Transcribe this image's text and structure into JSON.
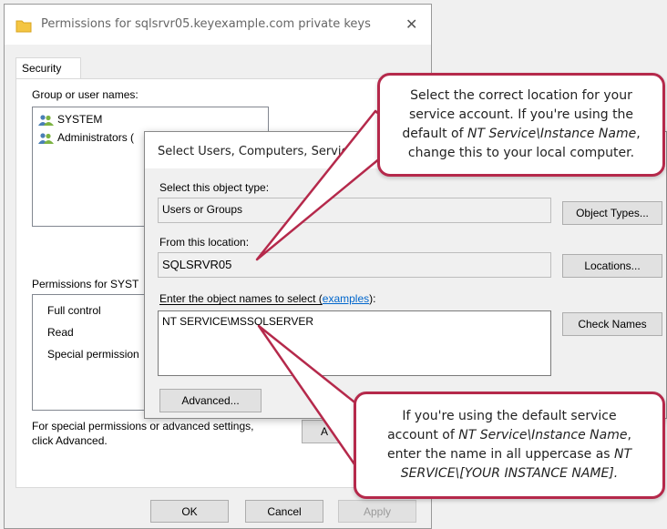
{
  "permissions_window": {
    "title": "Permissions for sqlsrvr05.keyexample.com private keys",
    "close_glyph": "✕",
    "tab_security": "Security",
    "group_label": "Group or user names:",
    "users": [
      "SYSTEM",
      "Administrators ("
    ],
    "perm_label": "Permissions for SYST",
    "perm_items": [
      "Full control",
      "Read",
      "Special permission"
    ],
    "special_text": "For special permissions or advanced settings,",
    "special_text2": "click Advanced.",
    "advanced_partial": "A",
    "ok": "OK",
    "cancel": "Cancel",
    "apply": "Apply"
  },
  "select_dialog": {
    "title": "Select Users, Computers, Servic  Ac",
    "object_type_label": "Select this object type:",
    "object_type_value": "Users or Groups",
    "object_types_button": "Object Types...",
    "location_label": "From this location:",
    "location_value": "SQLSRVR05",
    "locations_button": "Locations...",
    "names_label_prefix": "Enter the object names to select (",
    "names_label_link": "examples",
    "names_label_suffix": "):",
    "names_value": "NT SERVICE\\MSSQLSERVER",
    "check_names_button": "Check Names",
    "advanced_button": "Advanced..."
  },
  "callouts": {
    "top": {
      "line1": "Select the correct location for your",
      "line2": "service account. If you're using the",
      "line3_prefix": "default of ",
      "line3_italic": "NT Service\\Instance Name",
      "line3_suffix": ",",
      "line4": "change this to your local computer."
    },
    "bottom": {
      "line1": "If you're using the default service",
      "line2_prefix": "account of ",
      "line2_italic": "NT Service\\Instance Name",
      "line2_suffix": ",",
      "line3_prefix": "enter the name in all uppercase as ",
      "line3_italic": "NT",
      "line4_italic": "SERVICE\\[YOUR INSTANCE NAME].",
      "line4_suffix": ""
    }
  },
  "colors": {
    "callout_border": "#b5294b",
    "link": "#0066cc"
  },
  "icons": [
    "folder-icon",
    "user-group-icon",
    "close-icon"
  ]
}
